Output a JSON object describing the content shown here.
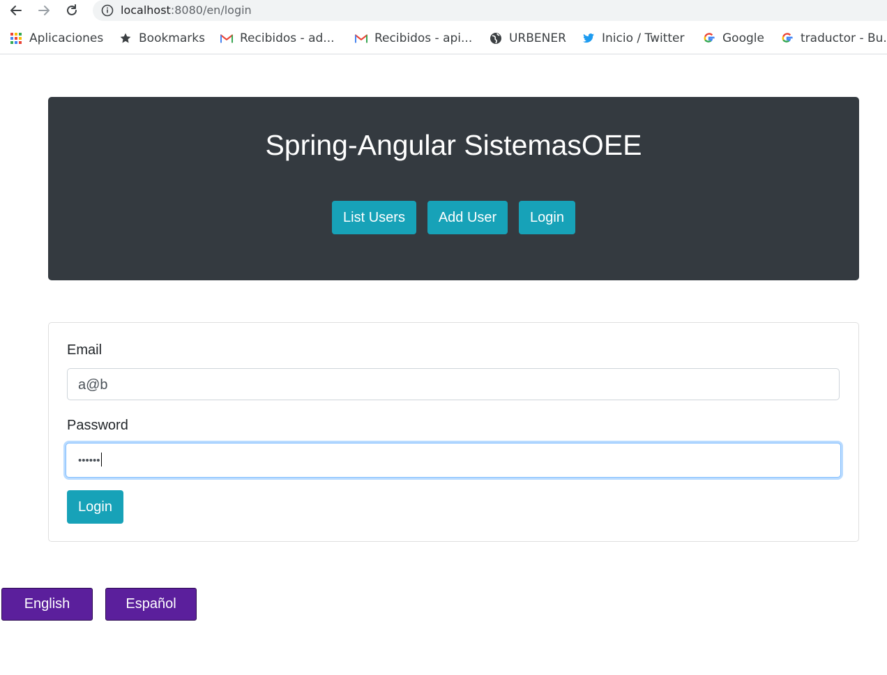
{
  "browser": {
    "url_host": "localhost",
    "url_rest": ":8080/en/login",
    "bookmarks": [
      {
        "label": "Aplicaciones",
        "icon": "apps-grid-icon"
      },
      {
        "label": "Bookmarks",
        "icon": "star-icon"
      },
      {
        "label": "Recibidos - ad...",
        "icon": "gmail-icon"
      },
      {
        "label": "Recibidos - api...",
        "icon": "gmail-icon"
      },
      {
        "label": "URBENER",
        "icon": "globe-icon"
      },
      {
        "label": "Inicio / Twitter",
        "icon": "twitter-icon"
      },
      {
        "label": "Google",
        "icon": "google-icon"
      },
      {
        "label": "traductor - Bu...",
        "icon": "google-icon"
      }
    ]
  },
  "header": {
    "title": "Spring-Angular SistemasOEE",
    "nav": {
      "list_users": "List Users",
      "add_user": "Add User",
      "login": "Login"
    }
  },
  "form": {
    "email_label": "Email",
    "email_value": "a@b",
    "password_label": "Password",
    "password_value": "••••••",
    "submit": "Login"
  },
  "language": {
    "english": "English",
    "espanol": "Español"
  },
  "colors": {
    "jumbotron": "#343a40",
    "info_button": "#17a2b8",
    "language_button": "#5b1f9c",
    "focus_ring": "#80bdff"
  }
}
